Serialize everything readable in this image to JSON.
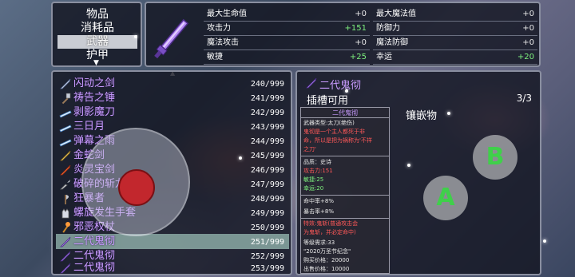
{
  "categories": {
    "items": [
      "物品",
      "消耗品",
      "武器",
      "护甲"
    ],
    "selected_index": 2,
    "more_arrow": "▼"
  },
  "stats": {
    "left": [
      {
        "name": "最大生命值",
        "value": "+0"
      },
      {
        "name": "攻击力",
        "value": "+151"
      },
      {
        "name": "魔法攻击",
        "value": "+0"
      },
      {
        "name": "敏捷",
        "value": "+25"
      }
    ],
    "right": [
      {
        "name": "最大魔法值",
        "value": "+0"
      },
      {
        "name": "防御力",
        "value": "+0"
      },
      {
        "name": "魔法防御",
        "value": "+0"
      },
      {
        "name": "幸运",
        "value": "+20"
      }
    ]
  },
  "list_scroll_arrow": "▲",
  "items": [
    {
      "name": "闪动之剑",
      "count": "240/999",
      "icon": "sword-icon"
    },
    {
      "name": "祷告之锤",
      "count": "241/999",
      "icon": "hammer-icon"
    },
    {
      "name": "剥影魔刀",
      "count": "242/999",
      "icon": "blade-icon"
    },
    {
      "name": "三日月",
      "count": "243/999",
      "icon": "blade-icon"
    },
    {
      "name": "弹幕之雨",
      "count": "244/999",
      "icon": "blade-icon"
    },
    {
      "name": "金蛇剑",
      "count": "245/999",
      "icon": "sword-icon"
    },
    {
      "name": "炎灵宝剑",
      "count": "246/999",
      "icon": "fire-sword-icon"
    },
    {
      "name": "破碎的斩龙剑",
      "count": "247/999",
      "icon": "broken-sword-icon"
    },
    {
      "name": "狂暴者",
      "count": "248/999",
      "icon": "axe-icon"
    },
    {
      "name": "螺旋发生手套",
      "count": "249/999",
      "icon": "glove-icon"
    },
    {
      "name": "邪恶权杖",
      "count": "250/999",
      "icon": "staff-icon"
    },
    {
      "name": "二代鬼彻",
      "count": "251/999",
      "icon": "purple-sword-icon"
    },
    {
      "name": "二代鬼彻",
      "count": "252/999",
      "icon": "purple-sword-icon"
    },
    {
      "name": "二代鬼彻",
      "count": "253/999",
      "icon": "purple-sword-icon"
    }
  ],
  "selected_item_index": 11,
  "detail": {
    "title": "二代鬼彻",
    "slot_label": "插槽可用",
    "slot_count": "3/3",
    "inlay_label": "镶嵌物",
    "desc_header": "二代鬼彻",
    "type_line": "武器类型:太刀(绝伤)",
    "description": [
      "鬼彻是一个主人都死于非",
      "命，所以是把为祸称为'不祥",
      "之刀'"
    ],
    "quality": "品质：史诗",
    "stats": [
      {
        "text": "攻击力:151",
        "color": "red"
      },
      {
        "text": "敏捷:25",
        "color": "green"
      },
      {
        "text": "幸运:20",
        "color": "green"
      }
    ],
    "bonus": [
      {
        "text": "命中率+8%",
        "color": "white"
      },
      {
        "text": "暴击率+8%",
        "color": "white"
      }
    ],
    "special": [
      "特效:鬼斩(普通攻击会",
      "为鬼斩，并必定命中)"
    ],
    "level_req": "等级需求:33",
    "note": "\"2020万圣节纪念\"",
    "buy_price": "购买价格：20000",
    "sell_price": "出售价格：10000"
  },
  "controls": {
    "button_b": "B",
    "button_a": "A"
  },
  "colors": {
    "item_name": "#c99bff",
    "stat_green": "#7df07d",
    "stat_red": "#ff5858",
    "button_letter": "#3fd04a",
    "joystick_knob": "#c2272d"
  }
}
